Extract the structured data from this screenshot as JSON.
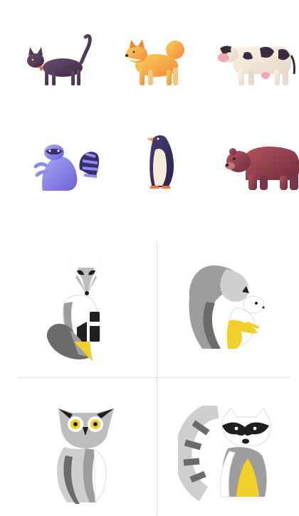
{
  "gallery": {
    "top_row_1": [
      {
        "icon": "cat-icon",
        "color": "#5b3d5c"
      },
      {
        "icon": "shiba-dog-icon",
        "color": "#f4a241"
      },
      {
        "icon": "cow-icon",
        "color": "#f1e7df"
      }
    ],
    "top_row_2": [
      {
        "icon": "raccoon-icon",
        "color": "#8a86e8"
      },
      {
        "icon": "penguin-icon",
        "color": "#3b2f63"
      },
      {
        "icon": "bear-icon",
        "color": "#93404d"
      }
    ],
    "bottom_grid": [
      {
        "icon": "fox-icon",
        "accent": "#f2d02a"
      },
      {
        "icon": "squirrel-icon",
        "accent": "#f2d02a"
      },
      {
        "icon": "owl-icon",
        "accent": "#f2d02a"
      },
      {
        "icon": "raccoon-mono-icon",
        "accent": "#f2d02a"
      }
    ],
    "palette": {
      "gray_light": "#cfcfcf",
      "gray_mid": "#9d9d9d",
      "gray_dark": "#6b6b6b",
      "black": "#1f1f1f",
      "yellow": "#f2d02a"
    }
  }
}
